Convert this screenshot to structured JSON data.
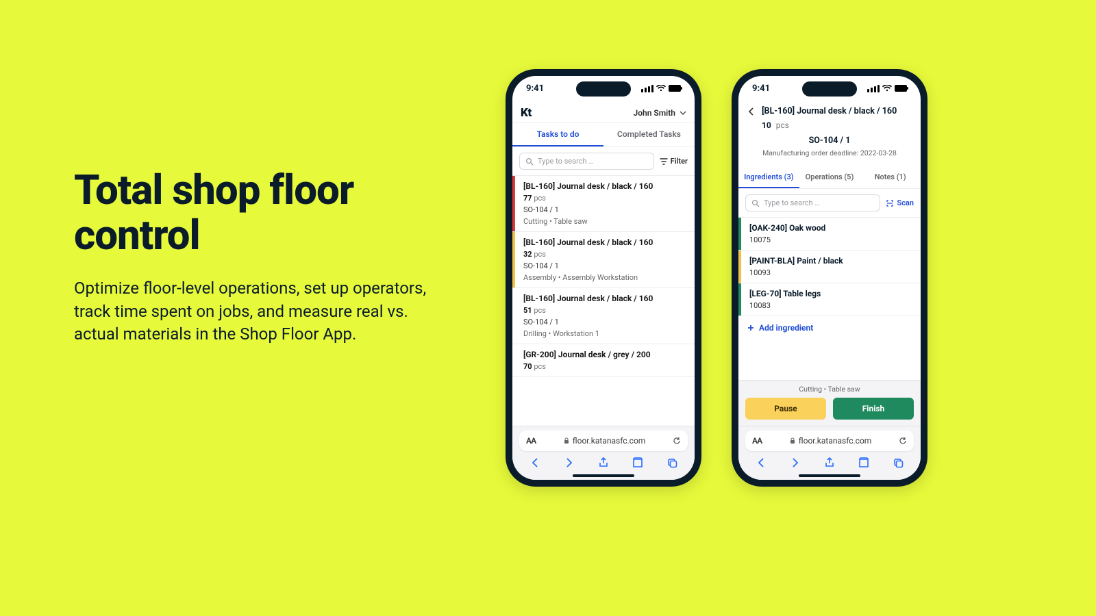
{
  "marketing": {
    "headline": "Total shop floor control",
    "body": "Optimize floor-level operations, set up operators, track time spent on jobs, and measure real vs. actual materials in the Shop Floor App."
  },
  "statusbar": {
    "time": "9:41"
  },
  "safari": {
    "url": "floor.katanasfc.com",
    "aa": "AA"
  },
  "phone1": {
    "logo": "Kt",
    "user": "John Smith",
    "tabs": {
      "todo": "Tasks to do",
      "done": "Completed Tasks"
    },
    "search_placeholder": "Type to search …",
    "filter_label": "Filter",
    "tasks": [
      {
        "stripe": "#d63a3a",
        "title": "[BL-160] Journal desk / black / 160",
        "qty": "77",
        "unit": "pcs",
        "so": "SO-104 / 1",
        "op": "Cutting  •  Table saw"
      },
      {
        "stripe": "#f1c24a",
        "title": "[BL-160] Journal desk / black / 160",
        "qty": "32",
        "unit": "pcs",
        "so": "SO-104 / 1",
        "op": "Assembly  •  Assembly Workstation"
      },
      {
        "stripe": "transparent",
        "title": "[BL-160] Journal desk / black / 160",
        "qty": "51",
        "unit": "pcs",
        "so": "SO-104 / 1",
        "op": "Drilling  •  Workstation 1"
      },
      {
        "stripe": "transparent",
        "title": "[GR-200] Journal desk / grey / 200",
        "qty": "70",
        "unit": "pcs"
      }
    ]
  },
  "phone2": {
    "title": "[BL-160] Journal desk / black / 160",
    "qty": "10",
    "unit": "pcs",
    "so": "SO-104 / 1",
    "deadline": "Manufacturing order deadline: 2022-03-28",
    "tabs": {
      "ing": "Ingredients (3)",
      "ops": "Operations (5)",
      "notes": "Notes (1)"
    },
    "search_placeholder": "Type to search …",
    "scan_label": "Scan",
    "ingredients": [
      {
        "stripe": "#1f8a5d",
        "name": "[OAK-240] Oak wood",
        "q": "10075"
      },
      {
        "stripe": "#f1c24a",
        "name": "[PAINT-BLA] Paint / black",
        "q": "10093"
      },
      {
        "stripe": "#1f8a5d",
        "name": "[LEG-70] Table legs",
        "q": "10083"
      }
    ],
    "add_label": "Add ingredient",
    "opbar_label": "Cutting  •  Table saw",
    "pause_label": "Pause",
    "finish_label": "Finish"
  }
}
